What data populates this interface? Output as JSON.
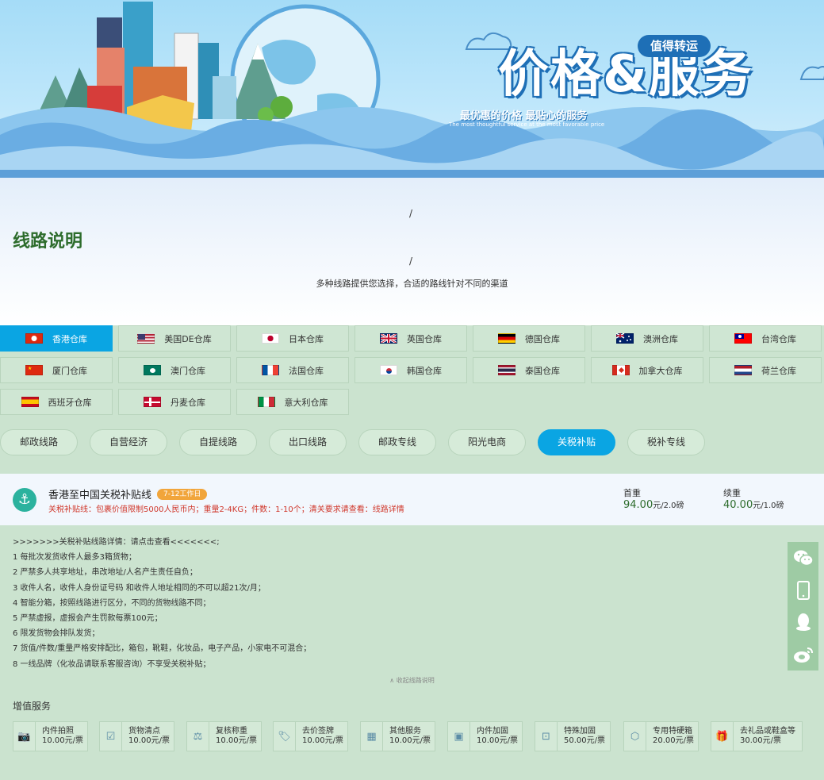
{
  "banner": {
    "title": "价格&服务",
    "badge": "值得转运",
    "slogan": "最优惠的价格 最贴心的服务",
    "slogan_en": "The most thoughtful service at the most favorable price"
  },
  "intro": {
    "slash_top": "/",
    "title": "线路说明",
    "slash_bottom": "/",
    "subtitle": "多种线路提供您选择，合适的路线针对不同的渠道"
  },
  "warehouses": [
    {
      "label": "香港仓库",
      "flag": "hk-flag-icon",
      "active": true
    },
    {
      "label": "美国DE仓库",
      "flag": "us-flag-icon",
      "active": false
    },
    {
      "label": "日本仓库",
      "flag": "jp-flag-icon",
      "active": false
    },
    {
      "label": "英国仓库",
      "flag": "uk-flag-icon",
      "active": false
    },
    {
      "label": "德国仓库",
      "flag": "de-flag-icon",
      "active": false
    },
    {
      "label": "澳洲仓库",
      "flag": "au-flag-icon",
      "active": false
    },
    {
      "label": "台湾仓库",
      "flag": "tw-flag-icon",
      "active": false
    },
    {
      "label": "厦门仓库",
      "flag": "cn-flag-icon",
      "active": false
    },
    {
      "label": "澳门仓库",
      "flag": "mo-flag-icon",
      "active": false
    },
    {
      "label": "法国仓库",
      "flag": "fr-flag-icon",
      "active": false
    },
    {
      "label": "韩国仓库",
      "flag": "kr-flag-icon",
      "active": false
    },
    {
      "label": "泰国仓库",
      "flag": "th-flag-icon",
      "active": false
    },
    {
      "label": "加拿大仓库",
      "flag": "ca-flag-icon",
      "active": false
    },
    {
      "label": "荷兰仓库",
      "flag": "nl-flag-icon",
      "active": false
    },
    {
      "label": "西班牙仓库",
      "flag": "es-flag-icon",
      "active": false
    },
    {
      "label": "丹麦仓库",
      "flag": "dk-flag-icon",
      "active": false
    },
    {
      "label": "意大利仓库",
      "flag": "it-flag-icon",
      "active": false
    }
  ],
  "routes": [
    {
      "label": "邮政线路",
      "active": false
    },
    {
      "label": "自营经济",
      "active": false
    },
    {
      "label": "自提线路",
      "active": false
    },
    {
      "label": "出口线路",
      "active": false
    },
    {
      "label": "邮政专线",
      "active": false
    },
    {
      "label": "阳光电商",
      "active": false
    },
    {
      "label": "关税补贴",
      "active": true
    },
    {
      "label": "税补专线",
      "active": false
    }
  ],
  "route_card": {
    "icon": "anchor-icon",
    "name": "香港至中国关税补贴线",
    "tag": "7-12工作日",
    "desc_prefix": "关税补贴线：包裹价值限制5000人民币内；重量2-4KG；件数：1-10个；清关要求请查看：",
    "desc_link": "线路详情",
    "first_weight_label": "首重",
    "first_weight_price": "94.00",
    "first_weight_unit": "元/2.0磅",
    "next_weight_label": "续重",
    "next_weight_price": "40.00",
    "next_weight_unit": "元/1.0磅"
  },
  "details": [
    ">>>>>>>关税补贴线路详情：请点击查看<<<<<<<;",
    "1 每批次发货收件人最多3箱货物；",
    "2 严禁多人共享地址，串改地址/人名产生责任自负；",
    "3 收件人名，收件人身份证号码 和收件人地址相同的不可以超21次/月；",
    "4 智能分箱，按照线路进行区分，不同的货物线路不同；",
    "5 严禁虚报，虚报会产生罚款每票100元；",
    "6 限发货物会排队发货；",
    "7 货值/件数/重量严格安排配比，箱包，靴鞋，化妆品，电子产品，小家电不可混合；",
    "8 一线品牌（化妆品请联系客服咨询）不享受关税补贴；"
  ],
  "collapse_label": "∧ 收起线路说明",
  "services": {
    "title": "增值服务",
    "items": [
      {
        "name": "内件拍照",
        "price": "10.00元/票",
        "icon": "camera-icon"
      },
      {
        "name": "货物清点",
        "price": "10.00元/票",
        "icon": "checklist-icon"
      },
      {
        "name": "复核称重",
        "price": "10.00元/票",
        "icon": "scale-icon"
      },
      {
        "name": "去价签牌",
        "price": "10.00元/票",
        "icon": "tag-icon"
      },
      {
        "name": "其他服务",
        "price": "10.00元/票",
        "icon": "grid-icon"
      },
      {
        "name": "内件加固",
        "price": "10.00元/票",
        "icon": "box-icon"
      },
      {
        "name": "特殊加固",
        "price": "50.00元/票",
        "icon": "package-icon"
      },
      {
        "name": "专用特硬箱",
        "price": "20.00元/票",
        "icon": "cube-icon"
      },
      {
        "name": "去礼品或鞋盒等",
        "price": "30.00元/票",
        "icon": "gift-icon"
      }
    ]
  },
  "side_bar": [
    "wechat-icon",
    "phone-icon",
    "qq-icon",
    "weibo-icon"
  ]
}
